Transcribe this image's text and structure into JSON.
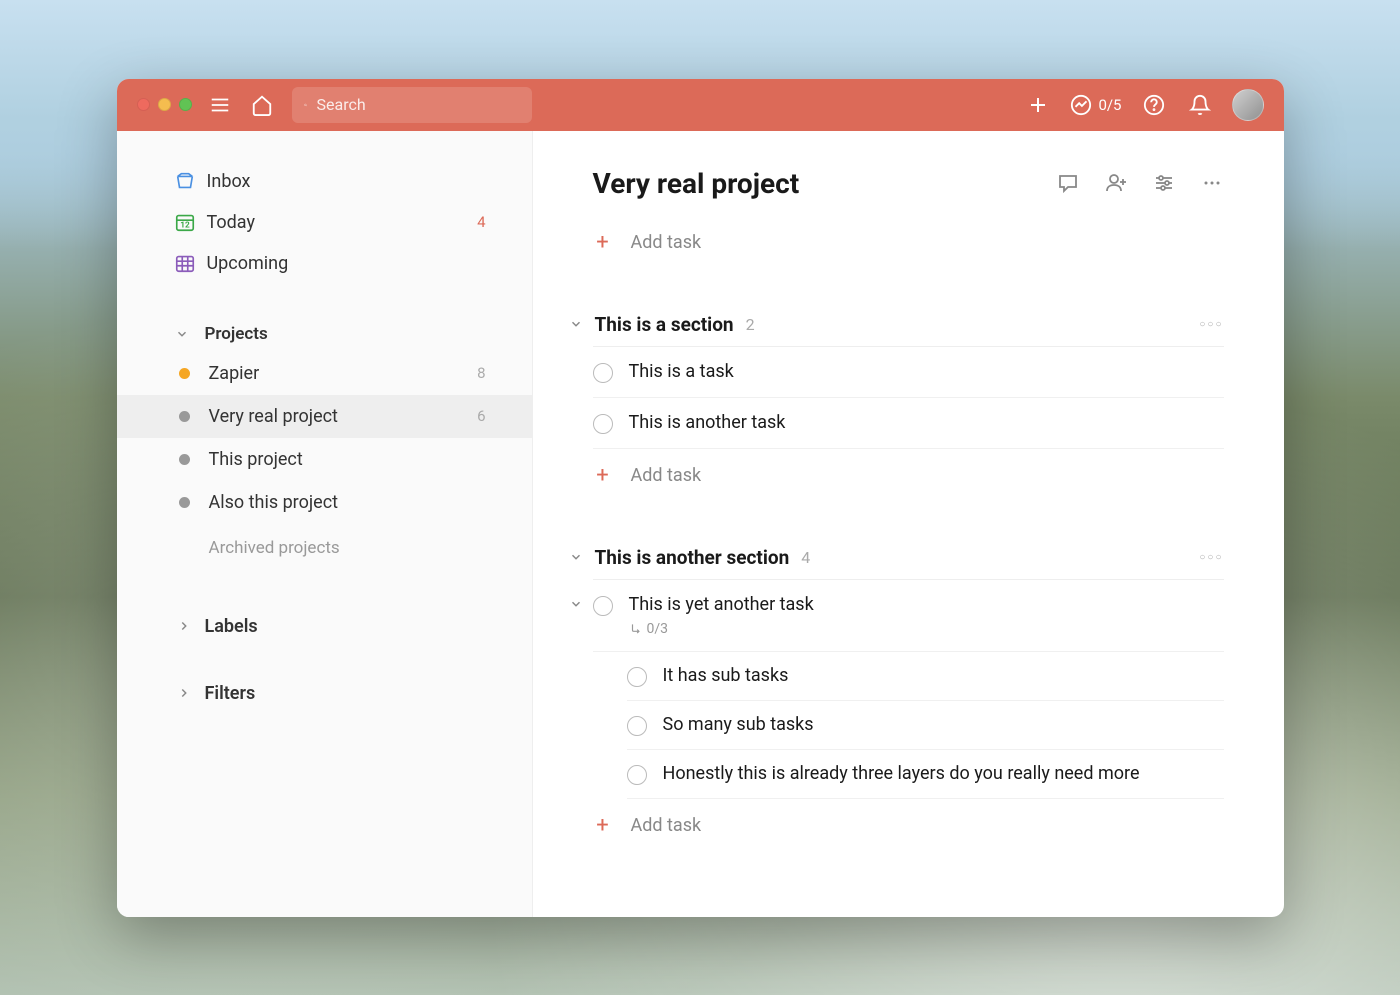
{
  "titlebar": {
    "search_placeholder": "Search",
    "productivity_count": "0/5"
  },
  "sidebar": {
    "nav": [
      {
        "id": "inbox",
        "label": "Inbox",
        "count": ""
      },
      {
        "id": "today",
        "label": "Today",
        "count": "4"
      },
      {
        "id": "upcoming",
        "label": "Upcoming",
        "count": ""
      }
    ],
    "projects_header": "Projects",
    "projects": [
      {
        "label": "Zapier",
        "count": "8",
        "color": "orange",
        "active": false
      },
      {
        "label": "Very real project",
        "count": "6",
        "color": "grey",
        "active": true
      },
      {
        "label": "This project",
        "count": "",
        "color": "grey",
        "active": false
      },
      {
        "label": "Also this project",
        "count": "",
        "color": "grey",
        "active": false
      }
    ],
    "archived_label": "Archived projects",
    "labels_header": "Labels",
    "filters_header": "Filters"
  },
  "main": {
    "project_title": "Very real project",
    "add_task_label": "Add task",
    "sections": [
      {
        "title": "This is a section",
        "count": "2",
        "tasks": [
          {
            "title": "This is a task"
          },
          {
            "title": "This is another task"
          }
        ]
      },
      {
        "title": "This is another section",
        "count": "4",
        "tasks": [
          {
            "title": "This is yet another task",
            "subtask_progress": "0/3",
            "expanded": true,
            "subtasks": [
              {
                "title": "It has sub tasks"
              },
              {
                "title": "So many sub tasks"
              },
              {
                "title": "Honestly this is already three layers do you really need more"
              }
            ]
          }
        ]
      }
    ]
  }
}
